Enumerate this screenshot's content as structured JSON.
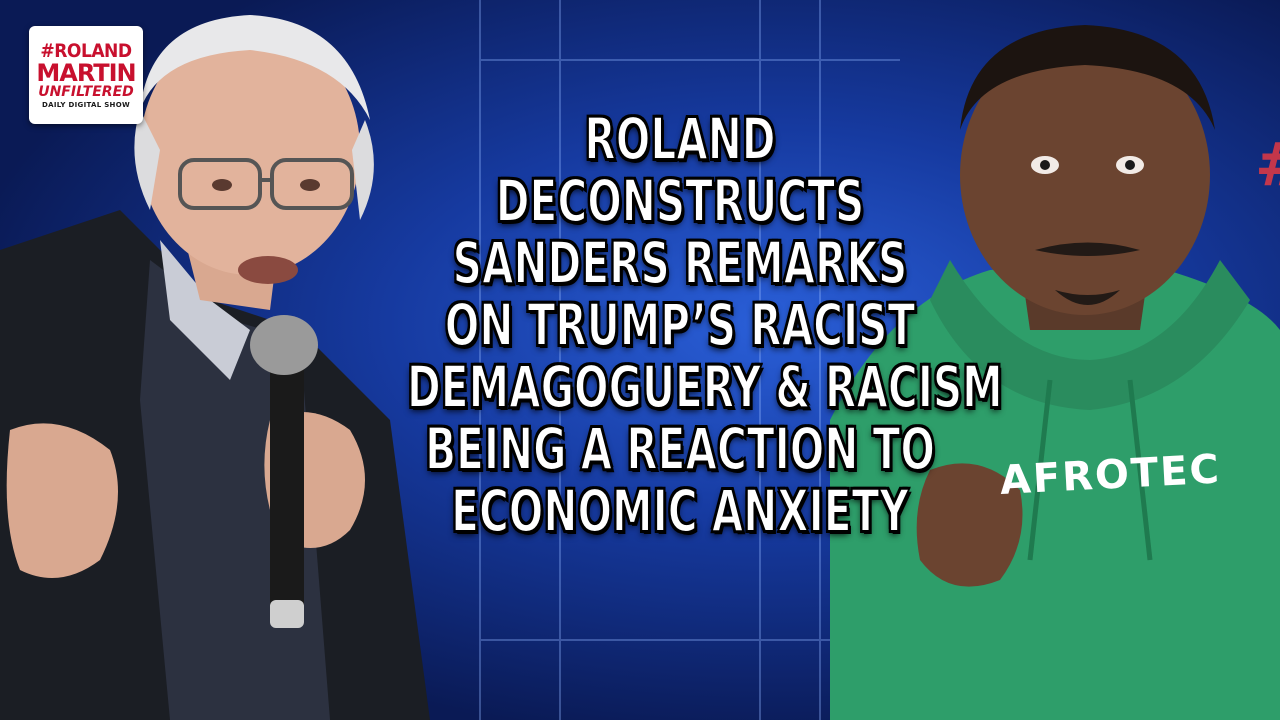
{
  "logo": {
    "line1": "#ROLAND",
    "line2": "MARTIN",
    "line3": "UNFILTERED",
    "line4": "DAILY DIGITAL SHOW"
  },
  "headline": {
    "lines": [
      "ROLAND",
      "DECONSTRUCTS",
      "SANDERS REMARKS",
      "ON TRUMP’S RACIST",
      "DEMAGOGUERY & RACISM",
      "BEING A REACTION TO",
      "ECONOMIC ANXIETY"
    ]
  },
  "hoodie_text": "AFROTEC",
  "background_mark": "#",
  "colors": {
    "background": "#163aa0",
    "logo_red": "#c8102e",
    "hoodie_green": "#2e9e6a",
    "headline_text": "#ffffff"
  }
}
